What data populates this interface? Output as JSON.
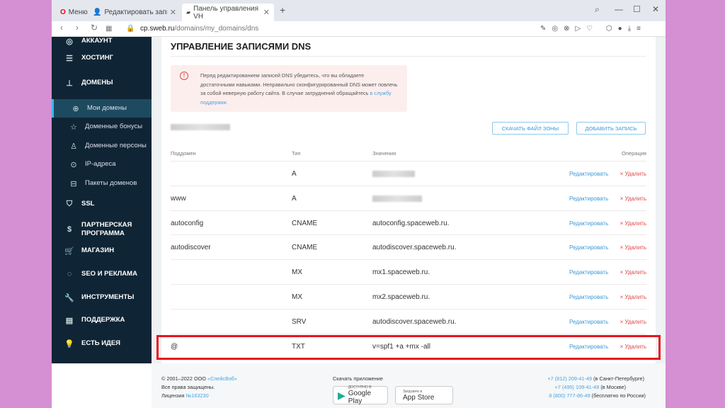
{
  "browser": {
    "tabs": [
      {
        "label": "Меню",
        "icon": "opera-icon"
      },
      {
        "label": "Редактировать запись \"Li",
        "icon": "user-icon"
      },
      {
        "label": "Панель управления VH",
        "icon": "sweb-icon"
      }
    ],
    "url_host": "cp.sweb.ru",
    "url_path": "/domains/my_domains/dns"
  },
  "sidebar": {
    "items": [
      {
        "label": "Аккаунт",
        "icon": "user-circle-icon"
      },
      {
        "label": "Хостинг",
        "icon": "server-icon"
      },
      {
        "label": "Домены",
        "icon": "sitemap-icon"
      },
      {
        "label": "Мои домены",
        "icon": "globe-icon"
      },
      {
        "label": "Доменные бонусы",
        "icon": "star-icon"
      },
      {
        "label": "Доменные персоны",
        "icon": "persons-icon"
      },
      {
        "label": "IP-адреса",
        "icon": "pin-icon"
      },
      {
        "label": "Пакеты доменов",
        "icon": "briefcase-icon"
      },
      {
        "label": "SSL",
        "icon": "shield-icon"
      },
      {
        "label": "Партнерская программа",
        "icon": "money-bag-icon"
      },
      {
        "label": "Магазин",
        "icon": "cart-icon"
      },
      {
        "label": "SEO и реклама",
        "icon": "seo-icon"
      },
      {
        "label": "Инструменты",
        "icon": "wrench-icon"
      },
      {
        "label": "Поддержка",
        "icon": "support-icon"
      },
      {
        "label": "Есть идея",
        "icon": "lightbulb-icon"
      }
    ]
  },
  "main": {
    "title": "Управление записями DNS",
    "alert": {
      "text": "Перед редактированием записей DNS убедитесь, что вы обладаете достаточными навыками. Неправильно сконфигурированный DNS может повлечь за собой неверную работу сайта. В случае затруднений обращайтесь ",
      "link": "в службу поддержки."
    },
    "download_zone": "Скачать файл зоны",
    "add_record": "Добавить запись",
    "columns": [
      "Поддомен",
      "Тип",
      "Значения",
      "Операция"
    ],
    "edit_label": "Редактировать",
    "delete_label": "× Удалить",
    "rows": [
      {
        "sub": "",
        "type": "A",
        "value": ""
      },
      {
        "sub": "www",
        "type": "A",
        "value": ""
      },
      {
        "sub": "autoconfig",
        "type": "CNAME",
        "value": "autoconfig.spaceweb.ru."
      },
      {
        "sub": "autodiscover",
        "type": "CNAME",
        "value": "autodiscover.spaceweb.ru."
      },
      {
        "sub": "",
        "type": "MX",
        "value": "mx1.spaceweb.ru."
      },
      {
        "sub": "",
        "type": "MX",
        "value": "mx2.spaceweb.ru."
      },
      {
        "sub": "",
        "type": "SRV",
        "value": "autodiscover.spaceweb.ru."
      },
      {
        "sub": "@",
        "type": "TXT",
        "value": "v=spf1 +a +mx -all"
      }
    ]
  },
  "footer": {
    "copyright": "© 2001–2022 ООО ",
    "company": "«СпейсВэб»",
    "rights": "Все права защищены.",
    "license": "Лицензия ",
    "license_no": "№163230",
    "download_app": "Скачать приложение",
    "gplay_small": "ДОСТУПНО В",
    "gplay": "Google Play",
    "appstore_small": "Загрузите в",
    "appstore": "App Store",
    "phones": [
      {
        "num": "+7 (812) 209-41-49",
        "note": " (в Санкт-Петербурге)"
      },
      {
        "num": "+7 (495) 109-41-49",
        "note": " (в Москве)"
      },
      {
        "num": "8 (800) 777-86-49",
        "note": " (бесплатно по России)"
      }
    ]
  }
}
